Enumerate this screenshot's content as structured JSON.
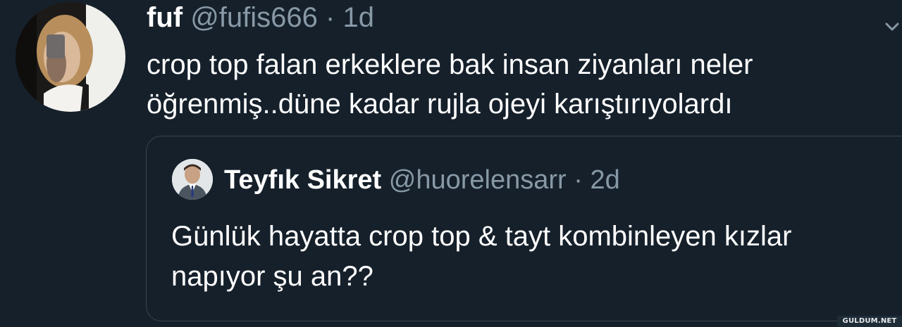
{
  "tweet": {
    "display_name": "fuf",
    "handle": "@fufis666",
    "separator": "·",
    "time": "1d",
    "text_line1": "crop top falan erkeklere bak insan ziyanları neler",
    "text_line2": "öğrenmiş..düne kadar rujla ojeyi karıştırıyolardı"
  },
  "quoted_tweet": {
    "display_name": "Teyfık Sikret",
    "handle": "@huorelensarr",
    "separator": "·",
    "time": "2d",
    "text_line1": "Günlük hayatta crop top & tayt kombinleyen kızlar",
    "text_line2": "napıyor şu an??"
  },
  "watermark": "GULDUM.NET",
  "colors": {
    "background": "#15202b",
    "text_primary": "#ffffff",
    "text_secondary": "#8899a6",
    "border": "#38444d"
  },
  "icons": {
    "menu": "chevron-down-icon"
  }
}
